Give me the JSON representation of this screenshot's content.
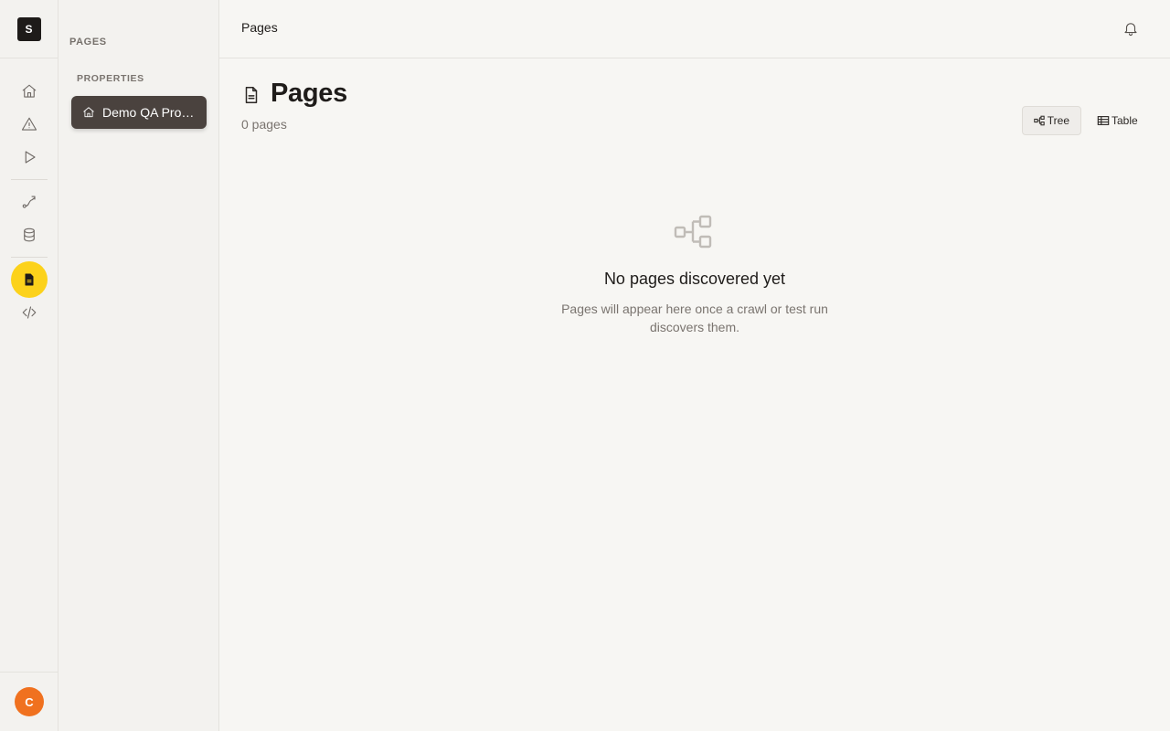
{
  "app": {
    "logo_letter": "S"
  },
  "rail": {
    "items": [
      {
        "name": "home",
        "icon": "home-icon"
      },
      {
        "name": "issues",
        "icon": "warning-icon"
      },
      {
        "name": "runs",
        "icon": "play-icon"
      },
      {
        "name": "flows",
        "icon": "route-icon"
      },
      {
        "name": "data",
        "icon": "database-icon"
      },
      {
        "name": "pages",
        "icon": "page-icon",
        "active": true
      },
      {
        "name": "code",
        "icon": "code-icon"
      }
    ],
    "user_initial": "C",
    "active_color": "#fcd21b",
    "avatar_color": "#f0711f"
  },
  "sidebar": {
    "title": "PAGES",
    "section": "PROPERTIES",
    "items": [
      {
        "label": "Demo QA Properties",
        "icon": "home-icon"
      }
    ]
  },
  "topbar": {
    "breadcrumb": "Pages"
  },
  "main": {
    "title": "Pages",
    "count": "0 pages",
    "views": {
      "tree": "Tree",
      "table": "Table",
      "selected": "Tree"
    },
    "empty": {
      "title": "No pages discovered yet",
      "description": "Pages will appear here once a crawl or test run discovers them."
    }
  }
}
